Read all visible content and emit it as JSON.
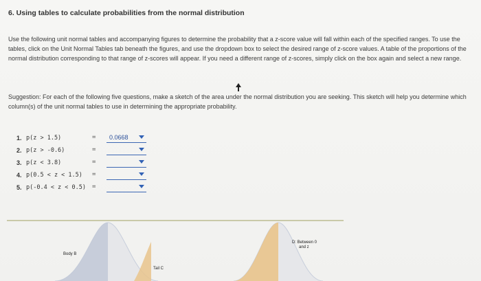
{
  "heading": "6. Using tables to calculate probabilities from the normal distribution",
  "instructions": "Use the following unit normal tables and accompanying figures to determine the probability that a z-score value will fall within each of the specified ranges. To use the tables, click on the Unit Normal Tables tab beneath the figures, and use the dropdown box to select the desired range of z-score values. A table of the proportions of the normal distribution corresponding to that range of z-scores will appear. If you need a different range of z-scores, simply click on the box again and select a new range.",
  "suggestion": "Suggestion: For each of the following five questions, make a sketch of the area under the normal distribution you are seeking. This sketch will help you determine which column(s) of the unit normal tables to use in determining the appropriate probability.",
  "questions": [
    {
      "num": "1.",
      "expr": "p(z > 1.5)",
      "eq": "=",
      "answer": "0.0668"
    },
    {
      "num": "2.",
      "expr": "p(z > -0.6)",
      "eq": "=",
      "answer": ""
    },
    {
      "num": "3.",
      "expr": "p(z < 3.8)",
      "eq": "=",
      "answer": ""
    },
    {
      "num": "4.",
      "expr": "p(0.5 < z < 1.5)",
      "eq": "=",
      "answer": ""
    },
    {
      "num": "5.",
      "expr": "p(-0.4 < z < 0.5)",
      "eq": "=",
      "answer": ""
    }
  ],
  "figure": {
    "label_body_b": "Body B",
    "label_tail_c": "Tail C",
    "label_between": "D: Between 0",
    "label_between_2": "and z",
    "fill_color": "#e9c48c",
    "curve_color": "#9fb0c8"
  },
  "icons": {
    "cursor": "mouse-pointer-icon",
    "dropdown": "chevron-down-icon"
  }
}
